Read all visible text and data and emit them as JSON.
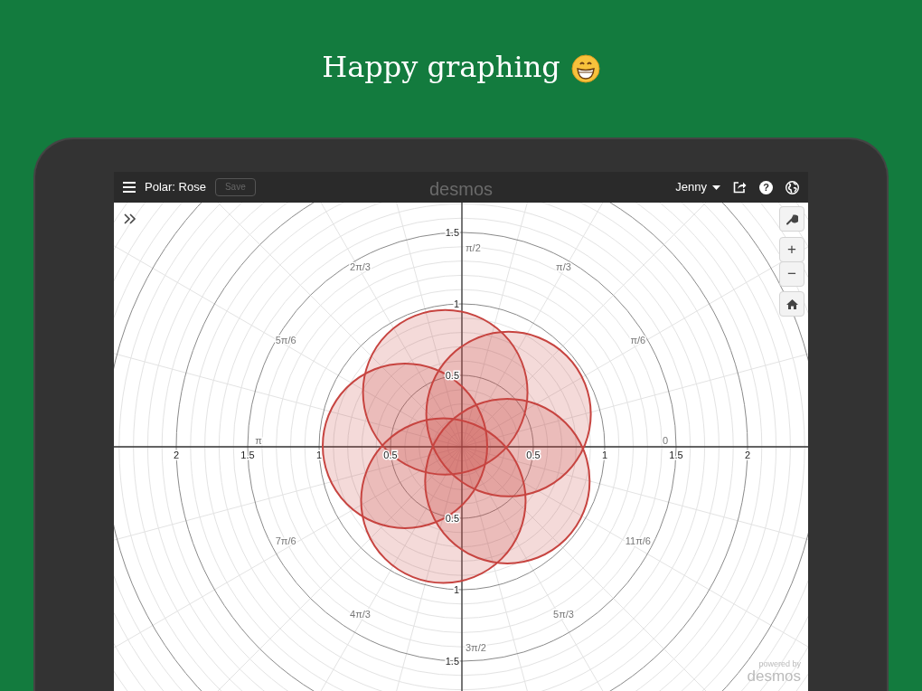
{
  "headline": {
    "text": "Happy graphing"
  },
  "toolbar": {
    "graph_title": "Polar: Rose",
    "save_button": {
      "label": "Save",
      "disabled": true
    },
    "logo": "desmos",
    "user": "Jenny",
    "help": "?"
  },
  "graph": {
    "zoom_buttons": [
      {
        "label": "+"
      },
      {
        "label": "−"
      }
    ],
    "x_tick_labels": [
      {
        "label": "2"
      },
      {
        "label": "1.5"
      },
      {
        "label": "1"
      },
      {
        "label": "0.5"
      },
      {
        "label": "0.5"
      },
      {
        "label": "1"
      },
      {
        "label": "1.5"
      },
      {
        "label": "2"
      }
    ],
    "y_tick_labels": [
      {
        "label": "1.5"
      },
      {
        "label": "1"
      },
      {
        "label": "0.5"
      },
      {
        "label": "0.5"
      },
      {
        "label": "1"
      },
      {
        "label": "1.5"
      }
    ],
    "angle_labels": [
      {
        "label": "0"
      },
      {
        "label": "π/6"
      },
      {
        "label": "π/3"
      },
      {
        "label": "π/2"
      },
      {
        "label": "2π/3"
      },
      {
        "label": "5π/6"
      },
      {
        "label": "π"
      },
      {
        "label": "7π/6"
      },
      {
        "label": "4π/3"
      },
      {
        "label": "3π/2"
      },
      {
        "label": "5π/3"
      },
      {
        "label": "11π/6"
      }
    ],
    "watermark": {
      "line_1": "powered by",
      "line_2": "desmos"
    }
  }
}
